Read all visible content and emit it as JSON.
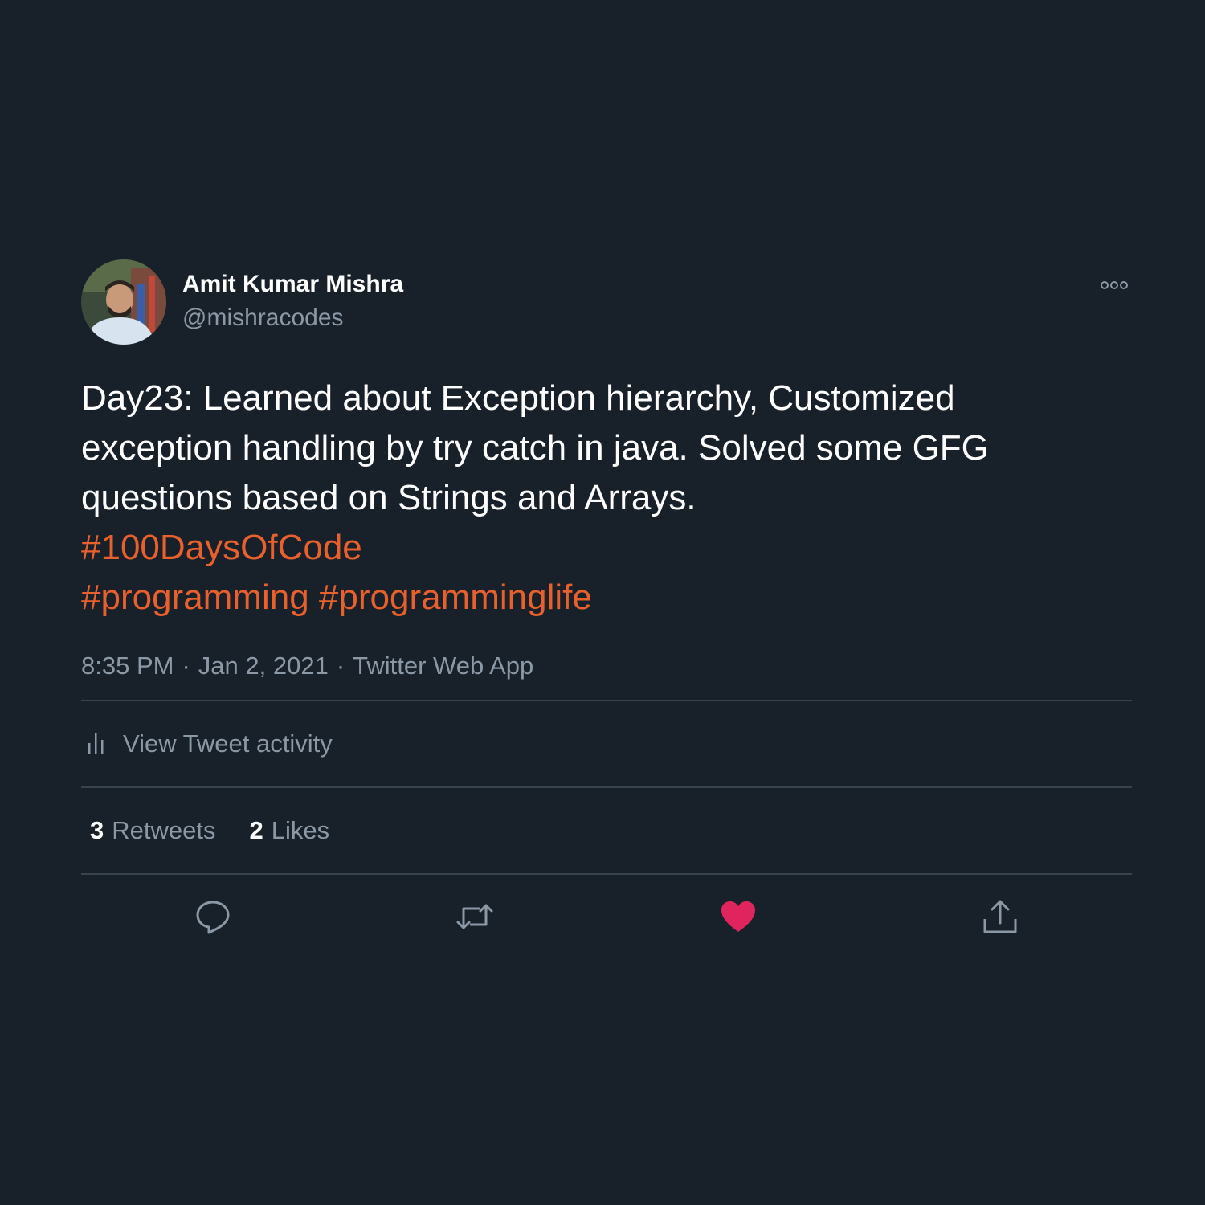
{
  "author": {
    "name": "Amit Kumar Mishra",
    "handle": "@mishracodes"
  },
  "tweet": {
    "lines": [
      "Day23: Learned about Exception hierarchy, Customized",
      "exception handling by try catch in java. Solved some GFG",
      "questions based on Strings and Arrays."
    ],
    "hashtags": [
      "#100DaysOfCode",
      "#programming",
      "#programminglife"
    ]
  },
  "meta": {
    "time": "8:35 PM",
    "date": "Jan 2, 2021",
    "source": "Twitter Web App",
    "separator": "·"
  },
  "activity": {
    "label": "View Tweet activity"
  },
  "stats": {
    "retweets_count": "3",
    "retweets_label": "Retweets",
    "likes_count": "2",
    "likes_label": "Likes"
  },
  "icons": {
    "more": "more-options-icon",
    "activity": "bar-chart-icon",
    "reply": "reply-icon",
    "retweet": "retweet-icon",
    "like": "heart-icon",
    "share": "share-icon"
  },
  "colors": {
    "background": "#18202a",
    "hashtag": "#e8602c",
    "secondary_text": "#8b98a5",
    "like_active": "#e0245e",
    "divider": "#38444d"
  }
}
